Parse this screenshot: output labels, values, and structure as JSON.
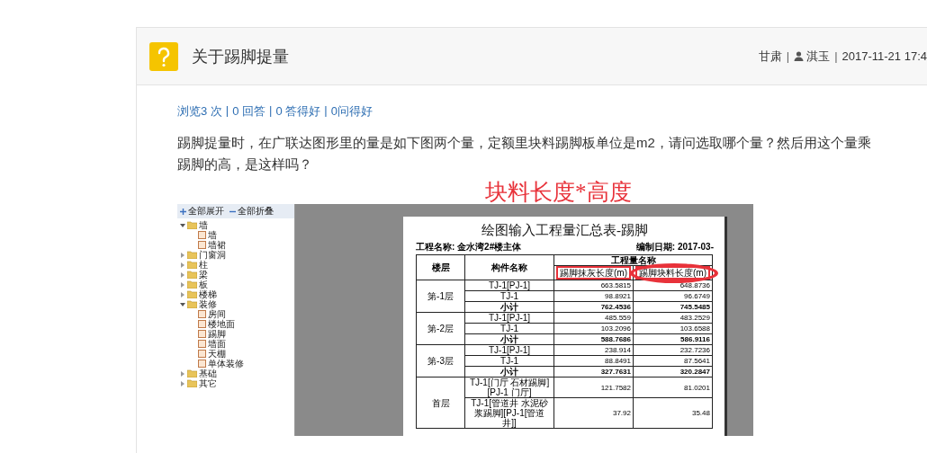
{
  "question": {
    "title": "关于踢脚提量",
    "location": "甘肃",
    "author": "淇玉",
    "datetime": "2017-11-21 17:4",
    "meta_separator": "|",
    "stats": [
      "浏览3 次",
      "0 回答",
      "0 答得好",
      "0问得好"
    ],
    "stats_separator": "|",
    "body_lines": [
      "踢脚提量时，在广联达图形里的量是如下图两个量，定额里块料踢脚板单位是m2，请问选取哪个量？然后用这个量乘",
      "踢脚的高，是这样吗？"
    ]
  },
  "attachment": {
    "annotation_text": "块料长度*高度",
    "tree": {
      "toolbar": [
        {
          "kind": "expand",
          "label": "全部展开"
        },
        {
          "kind": "collapse",
          "label": "全部折叠"
        }
      ],
      "items": [
        {
          "kind": "folder",
          "label": "墙",
          "expanded": true,
          "children": [
            {
              "kind": "file",
              "label": "墙"
            },
            {
              "kind": "file",
              "label": "墙裙"
            }
          ]
        },
        {
          "kind": "folder",
          "label": "门窗洞",
          "expanded": false
        },
        {
          "kind": "folder",
          "label": "柱",
          "expanded": false
        },
        {
          "kind": "folder",
          "label": "梁",
          "expanded": false
        },
        {
          "kind": "folder",
          "label": "板",
          "expanded": false
        },
        {
          "kind": "folder",
          "label": "楼梯",
          "expanded": false
        },
        {
          "kind": "folder",
          "label": "装修",
          "expanded": true,
          "children": [
            {
              "kind": "file",
              "label": "房间"
            },
            {
              "kind": "file",
              "label": "楼地面"
            },
            {
              "kind": "file",
              "label": "踢脚"
            },
            {
              "kind": "file",
              "label": "墙面"
            },
            {
              "kind": "file",
              "label": "天棚"
            },
            {
              "kind": "file",
              "label": "单体装修"
            }
          ]
        },
        {
          "kind": "folder",
          "label": "基础",
          "expanded": false
        },
        {
          "kind": "folder",
          "label": "其它",
          "expanded": false
        }
      ]
    },
    "report": {
      "title": "绘图输入工程量汇总表-踢脚",
      "project": "工程名称: 金水湾2#楼主体",
      "date": "编制日期: 2017-03-",
      "columns": [
        "楼层",
        "构件名称"
      ],
      "group_header": "工程量名称",
      "quantity_columns": [
        {
          "label": "踢脚抹灰长度(m)",
          "boxed": true,
          "circled": false
        },
        {
          "label": "踢脚块料长度(m)",
          "boxed": true,
          "circled": true
        }
      ],
      "floors": [
        {
          "name": "第-1层",
          "rows": [
            {
              "kind": "item",
              "component": "TJ-1[PJ-1]",
              "values": [
                "663.5815",
                "648.8736"
              ]
            },
            {
              "kind": "item",
              "component": "TJ-1",
              "values": [
                "98.8921",
                "96.6749"
              ]
            },
            {
              "kind": "subtotal",
              "component": "小计",
              "values": [
                "762.4536",
                "745.5485"
              ]
            }
          ]
        },
        {
          "name": "第-2层",
          "rows": [
            {
              "kind": "item",
              "component": "TJ-1[PJ-1]",
              "values": [
                "485.559",
                "483.2529"
              ]
            },
            {
              "kind": "item",
              "component": "TJ-1",
              "values": [
                "103.2096",
                "103.6588"
              ]
            },
            {
              "kind": "subtotal",
              "component": "小计",
              "values": [
                "588.7686",
                "586.9116"
              ]
            }
          ]
        },
        {
          "name": "第-3层",
          "rows": [
            {
              "kind": "item",
              "component": "TJ-1[PJ-1]",
              "values": [
                "238.914",
                "232.7236"
              ]
            },
            {
              "kind": "item",
              "component": "TJ-1",
              "values": [
                "88.8491",
                "87.5641"
              ]
            },
            {
              "kind": "subtotal",
              "component": "小计",
              "values": [
                "327.7631",
                "320.2847"
              ]
            }
          ]
        },
        {
          "name": "首层",
          "rows": [
            {
              "kind": "item",
              "component": "TJ-1[门厅 石材踢脚][PJ-1 门厅]",
              "values": [
                "121.7582",
                "81.0201"
              ]
            },
            {
              "kind": "item",
              "component": "TJ-1[管道井 水泥砂浆踢脚][PJ-1[管道井]]",
              "values": [
                "37.92",
                "35.48"
              ]
            }
          ]
        }
      ]
    }
  }
}
